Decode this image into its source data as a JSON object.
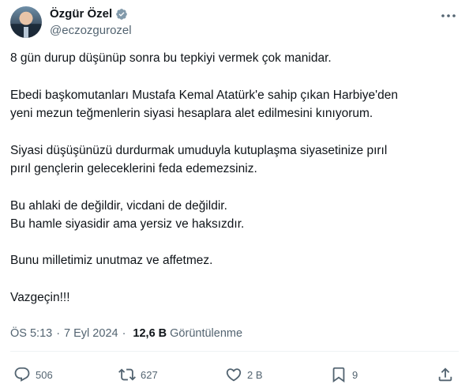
{
  "author": {
    "display_name": "Özgür Özel",
    "handle": "@eczozgurozel",
    "verified": true
  },
  "tweet": {
    "paragraphs": [
      "8 gün durup düşünüp sonra bu tepkiyi vermek çok manidar.",
      "Ebedi başkomutanları Mustafa Kemal Atatürk'e sahip çıkan Harbiye'den\nyeni mezun teğmenlerin siyasi hesaplara alet edilmesini kınıyorum.",
      "Siyasi düşüşünüzü durdurmak umuduyla kutuplaşma siyasetinize pırıl\npırıl gençlerin geleceklerini feda edemezsiniz.",
      "Bu ahlaki de değildir, vicdani de değildir.\nBu hamle siyasidir ama yersiz ve haksızdır.",
      "Bunu milletimiz unutmaz ve affetmez.",
      "Vazgeçin!!!"
    ]
  },
  "meta": {
    "time": "ÖS 5:13",
    "date": "7 Eyl 2024",
    "separator": "·",
    "views_count": "12,6 B",
    "views_label": "Görüntülenme"
  },
  "actions": {
    "replies": "506",
    "reposts": "627",
    "likes": "2 B",
    "bookmarks": "9"
  },
  "icons": {
    "verified": "verified-badge-icon",
    "more": "more-horizontal-icon",
    "reply": "reply-icon",
    "repost": "repost-icon",
    "like": "heart-icon",
    "bookmark": "bookmark-icon",
    "share": "share-icon"
  },
  "colors": {
    "text": "#0f1419",
    "secondary": "#536471",
    "verified_blue": "#1d9bf0",
    "divider": "#eff3f4"
  }
}
